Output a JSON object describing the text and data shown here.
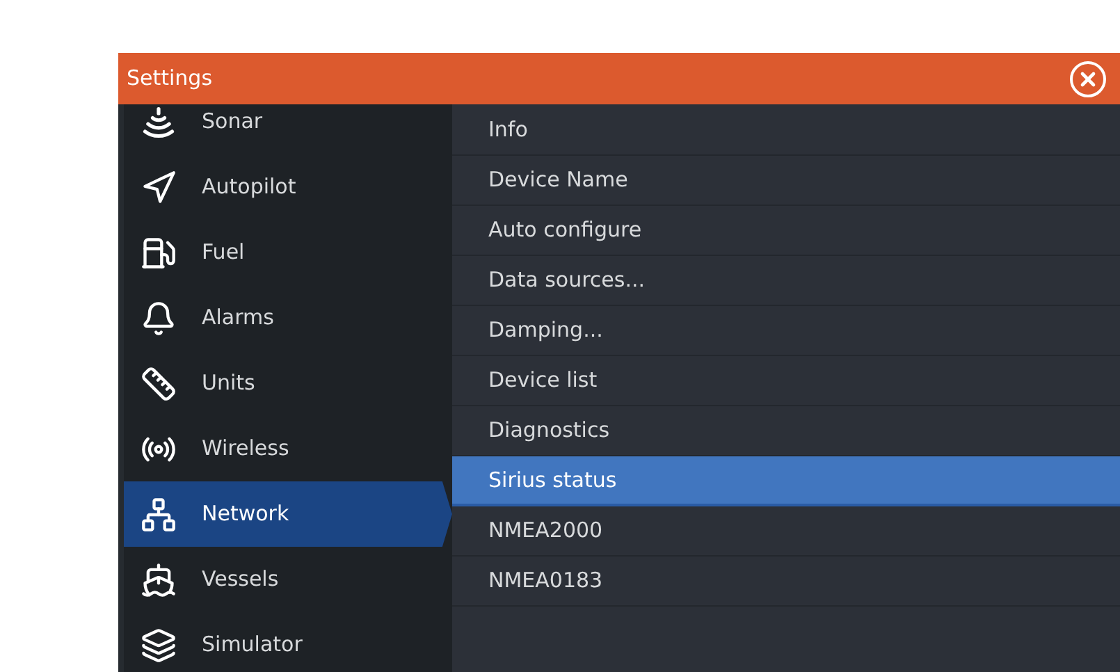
{
  "window": {
    "title": "Settings"
  },
  "sidebar": {
    "items": [
      {
        "label": "Sonar",
        "selected": false
      },
      {
        "label": "Autopilot",
        "selected": false
      },
      {
        "label": "Fuel",
        "selected": false
      },
      {
        "label": "Alarms",
        "selected": false
      },
      {
        "label": "Units",
        "selected": false
      },
      {
        "label": "Wireless",
        "selected": false
      },
      {
        "label": "Network",
        "selected": true
      },
      {
        "label": "Vessels",
        "selected": false
      },
      {
        "label": "Simulator",
        "selected": false
      }
    ]
  },
  "menu": {
    "items": [
      {
        "label": "Info",
        "selected": false
      },
      {
        "label": "Device Name",
        "selected": false
      },
      {
        "label": "Auto configure",
        "selected": false
      },
      {
        "label": "Data sources...",
        "selected": false
      },
      {
        "label": "Damping...",
        "selected": false
      },
      {
        "label": "Device list",
        "selected": false
      },
      {
        "label": "Diagnostics",
        "selected": false
      },
      {
        "label": "Sirius status",
        "selected": true
      },
      {
        "label": "NMEA2000",
        "selected": false
      },
      {
        "label": "NMEA0183",
        "selected": false
      }
    ]
  }
}
